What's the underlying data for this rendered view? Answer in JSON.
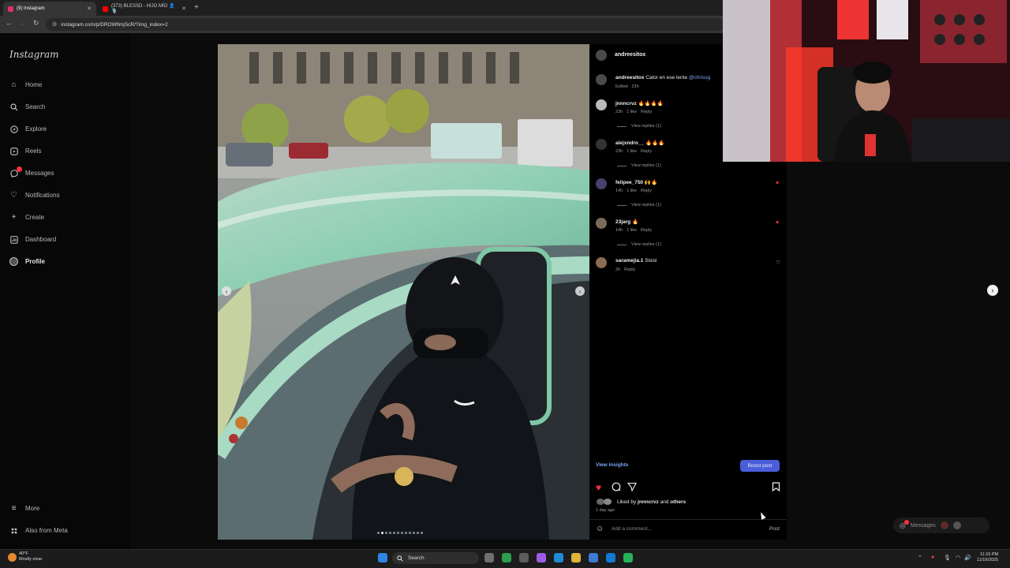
{
  "browser": {
    "tabs": [
      {
        "label": "(9) Instagram",
        "active": true,
        "favicon_color": "#e1306c"
      },
      {
        "label": "(373) BLESSD - HIJO MÍO 👤🎙️",
        "active": false,
        "favicon_color": "#ff0000"
      }
    ],
    "url": "instagram.com/p/DROWfimjScR/?img_index=2"
  },
  "sidebar": {
    "logo": "Instagram",
    "items": [
      {
        "label": "Home",
        "icon": "home-icon"
      },
      {
        "label": "Search",
        "icon": "search-icon"
      },
      {
        "label": "Explore",
        "icon": "compass-icon"
      },
      {
        "label": "Reels",
        "icon": "reels-icon"
      },
      {
        "label": "Messages",
        "icon": "messenger-icon"
      },
      {
        "label": "Notifications",
        "icon": "heart-icon"
      },
      {
        "label": "Create",
        "icon": "plus-icon"
      },
      {
        "label": "Dashboard",
        "icon": "dashboard-icon"
      },
      {
        "label": "Profile",
        "icon": "avatar-icon"
      }
    ],
    "bottom": [
      {
        "label": "More",
        "icon": "menu-icon"
      },
      {
        "label": "Also from Meta",
        "icon": "meta-icon"
      }
    ]
  },
  "post": {
    "author": "andreesitox",
    "caption_user": "andreesitox",
    "caption_text": "Calor en ese lente",
    "caption_mention": "@chrissg",
    "caption_meta": "Edited · 23h",
    "comments": [
      {
        "user": "jnnncrvz",
        "text": "🔥🔥🔥🔥",
        "time": "23h",
        "likes": "1 like",
        "reply": "Reply",
        "replies": "View replies (1)",
        "liked": false
      },
      {
        "user": "alejxndro__",
        "text": "🔥🔥🔥",
        "time": "23h",
        "likes": "1 like",
        "reply": "Reply",
        "replies": "View replies (1)",
        "liked": false
      },
      {
        "user": "felipee_750",
        "text": "🙌🔥",
        "time": "14h",
        "likes": "1 like",
        "reply": "Reply",
        "replies": "View replies (1)",
        "liked": true
      },
      {
        "user": "23jarg",
        "text": "🔥",
        "time": "14h",
        "likes": "1 like",
        "reply": "Reply",
        "replies": "View replies (1)",
        "liked": true
      },
      {
        "user": "saramejia.1",
        "text": "Sisisi",
        "time": "2h",
        "likes": "",
        "reply": "Reply",
        "replies": "",
        "liked": false
      }
    ],
    "view_insights": "View insights",
    "boost_post": "Boost post",
    "liked_by_prefix": "Liked by",
    "liked_by_user": "jnnncrvz",
    "liked_by_suffix": "and",
    "liked_by_others": "others",
    "time_ago": "1 day ago",
    "comment_placeholder": "Add a comment...",
    "post_button": "Post",
    "carousel_count": 12,
    "carousel_index": 2
  },
  "messages_pill": {
    "label": "Messages"
  },
  "taskbar": {
    "weather_temp": "40°F",
    "weather_desc": "Mostly clear",
    "search_label": "Search",
    "time": "11:16 PM",
    "date": "11/19/2025"
  },
  "colors": {
    "accent_blue": "#4a5dd9",
    "like_red": "#ff3040",
    "link_blue": "#7fa7ff"
  }
}
